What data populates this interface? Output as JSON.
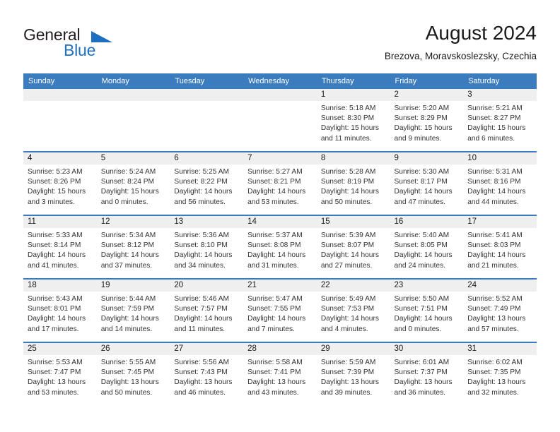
{
  "logo": {
    "word_one": "General",
    "word_two": "Blue",
    "accent_color": "#1f6fc0"
  },
  "header": {
    "title": "August 2024",
    "subtitle": "Brezova, Moravskoslezsky, Czechia"
  },
  "theme": {
    "header_blue": "#3b7cbf",
    "daynum_band": "#efefef",
    "text": "#1a1a1a"
  },
  "calendar": {
    "weekday_headers": [
      "Sunday",
      "Monday",
      "Tuesday",
      "Wednesday",
      "Thursday",
      "Friday",
      "Saturday"
    ],
    "weeks": [
      [
        {
          "day": "",
          "empty": true
        },
        {
          "day": "",
          "empty": true
        },
        {
          "day": "",
          "empty": true
        },
        {
          "day": "",
          "empty": true
        },
        {
          "day": "1",
          "sunrise": "Sunrise: 5:18 AM",
          "sunset": "Sunset: 8:30 PM",
          "daylight": "Daylight: 15 hours and 11 minutes."
        },
        {
          "day": "2",
          "sunrise": "Sunrise: 5:20 AM",
          "sunset": "Sunset: 8:29 PM",
          "daylight": "Daylight: 15 hours and 9 minutes."
        },
        {
          "day": "3",
          "sunrise": "Sunrise: 5:21 AM",
          "sunset": "Sunset: 8:27 PM",
          "daylight": "Daylight: 15 hours and 6 minutes."
        }
      ],
      [
        {
          "day": "4",
          "sunrise": "Sunrise: 5:23 AM",
          "sunset": "Sunset: 8:26 PM",
          "daylight": "Daylight: 15 hours and 3 minutes."
        },
        {
          "day": "5",
          "sunrise": "Sunrise: 5:24 AM",
          "sunset": "Sunset: 8:24 PM",
          "daylight": "Daylight: 15 hours and 0 minutes."
        },
        {
          "day": "6",
          "sunrise": "Sunrise: 5:25 AM",
          "sunset": "Sunset: 8:22 PM",
          "daylight": "Daylight: 14 hours and 56 minutes."
        },
        {
          "day": "7",
          "sunrise": "Sunrise: 5:27 AM",
          "sunset": "Sunset: 8:21 PM",
          "daylight": "Daylight: 14 hours and 53 minutes."
        },
        {
          "day": "8",
          "sunrise": "Sunrise: 5:28 AM",
          "sunset": "Sunset: 8:19 PM",
          "daylight": "Daylight: 14 hours and 50 minutes."
        },
        {
          "day": "9",
          "sunrise": "Sunrise: 5:30 AM",
          "sunset": "Sunset: 8:17 PM",
          "daylight": "Daylight: 14 hours and 47 minutes."
        },
        {
          "day": "10",
          "sunrise": "Sunrise: 5:31 AM",
          "sunset": "Sunset: 8:16 PM",
          "daylight": "Daylight: 14 hours and 44 minutes."
        }
      ],
      [
        {
          "day": "11",
          "sunrise": "Sunrise: 5:33 AM",
          "sunset": "Sunset: 8:14 PM",
          "daylight": "Daylight: 14 hours and 41 minutes."
        },
        {
          "day": "12",
          "sunrise": "Sunrise: 5:34 AM",
          "sunset": "Sunset: 8:12 PM",
          "daylight": "Daylight: 14 hours and 37 minutes."
        },
        {
          "day": "13",
          "sunrise": "Sunrise: 5:36 AM",
          "sunset": "Sunset: 8:10 PM",
          "daylight": "Daylight: 14 hours and 34 minutes."
        },
        {
          "day": "14",
          "sunrise": "Sunrise: 5:37 AM",
          "sunset": "Sunset: 8:08 PM",
          "daylight": "Daylight: 14 hours and 31 minutes."
        },
        {
          "day": "15",
          "sunrise": "Sunrise: 5:39 AM",
          "sunset": "Sunset: 8:07 PM",
          "daylight": "Daylight: 14 hours and 27 minutes."
        },
        {
          "day": "16",
          "sunrise": "Sunrise: 5:40 AM",
          "sunset": "Sunset: 8:05 PM",
          "daylight": "Daylight: 14 hours and 24 minutes."
        },
        {
          "day": "17",
          "sunrise": "Sunrise: 5:41 AM",
          "sunset": "Sunset: 8:03 PM",
          "daylight": "Daylight: 14 hours and 21 minutes."
        }
      ],
      [
        {
          "day": "18",
          "sunrise": "Sunrise: 5:43 AM",
          "sunset": "Sunset: 8:01 PM",
          "daylight": "Daylight: 14 hours and 17 minutes."
        },
        {
          "day": "19",
          "sunrise": "Sunrise: 5:44 AM",
          "sunset": "Sunset: 7:59 PM",
          "daylight": "Daylight: 14 hours and 14 minutes."
        },
        {
          "day": "20",
          "sunrise": "Sunrise: 5:46 AM",
          "sunset": "Sunset: 7:57 PM",
          "daylight": "Daylight: 14 hours and 11 minutes."
        },
        {
          "day": "21",
          "sunrise": "Sunrise: 5:47 AM",
          "sunset": "Sunset: 7:55 PM",
          "daylight": "Daylight: 14 hours and 7 minutes."
        },
        {
          "day": "22",
          "sunrise": "Sunrise: 5:49 AM",
          "sunset": "Sunset: 7:53 PM",
          "daylight": "Daylight: 14 hours and 4 minutes."
        },
        {
          "day": "23",
          "sunrise": "Sunrise: 5:50 AM",
          "sunset": "Sunset: 7:51 PM",
          "daylight": "Daylight: 14 hours and 0 minutes."
        },
        {
          "day": "24",
          "sunrise": "Sunrise: 5:52 AM",
          "sunset": "Sunset: 7:49 PM",
          "daylight": "Daylight: 13 hours and 57 minutes."
        }
      ],
      [
        {
          "day": "25",
          "sunrise": "Sunrise: 5:53 AM",
          "sunset": "Sunset: 7:47 PM",
          "daylight": "Daylight: 13 hours and 53 minutes."
        },
        {
          "day": "26",
          "sunrise": "Sunrise: 5:55 AM",
          "sunset": "Sunset: 7:45 PM",
          "daylight": "Daylight: 13 hours and 50 minutes."
        },
        {
          "day": "27",
          "sunrise": "Sunrise: 5:56 AM",
          "sunset": "Sunset: 7:43 PM",
          "daylight": "Daylight: 13 hours and 46 minutes."
        },
        {
          "day": "28",
          "sunrise": "Sunrise: 5:58 AM",
          "sunset": "Sunset: 7:41 PM",
          "daylight": "Daylight: 13 hours and 43 minutes."
        },
        {
          "day": "29",
          "sunrise": "Sunrise: 5:59 AM",
          "sunset": "Sunset: 7:39 PM",
          "daylight": "Daylight: 13 hours and 39 minutes."
        },
        {
          "day": "30",
          "sunrise": "Sunrise: 6:01 AM",
          "sunset": "Sunset: 7:37 PM",
          "daylight": "Daylight: 13 hours and 36 minutes."
        },
        {
          "day": "31",
          "sunrise": "Sunrise: 6:02 AM",
          "sunset": "Sunset: 7:35 PM",
          "daylight": "Daylight: 13 hours and 32 minutes."
        }
      ]
    ]
  }
}
